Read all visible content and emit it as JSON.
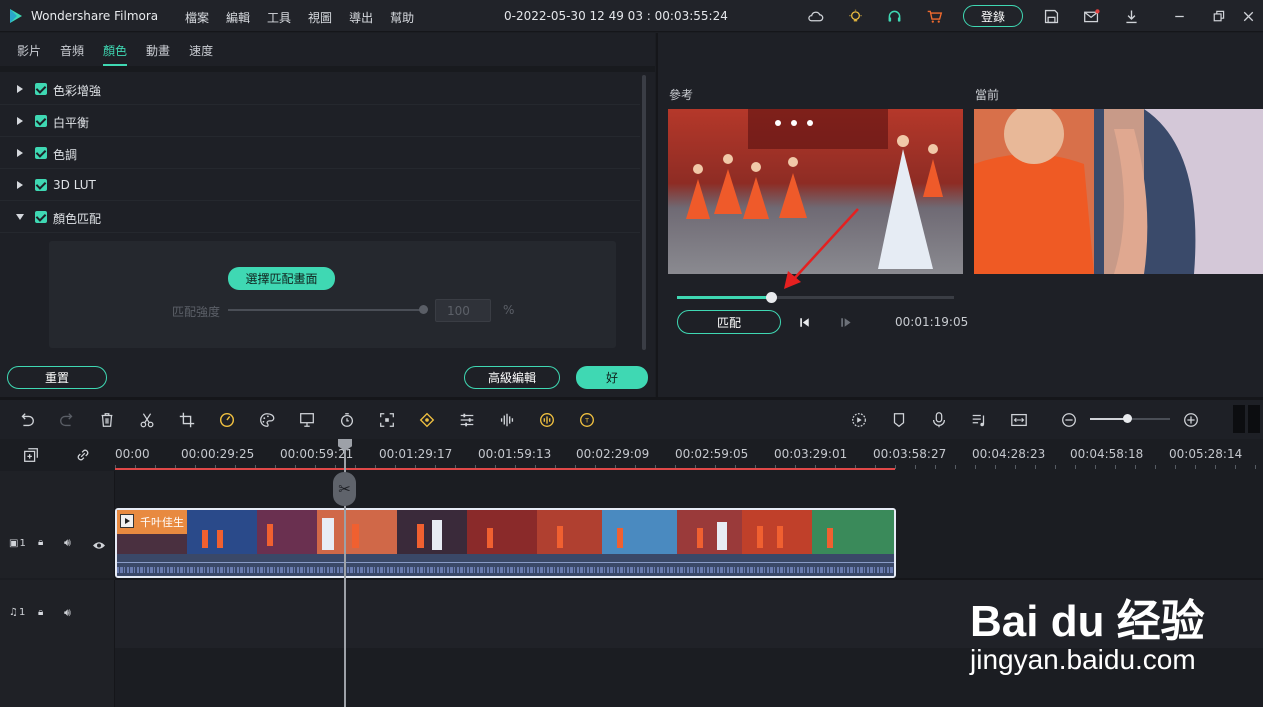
{
  "app": {
    "name": "Wondershare Filmora",
    "title": "0-2022-05-30 12 49 03 : 00:03:55:24",
    "login_label": "登錄"
  },
  "menu": [
    "檔案",
    "編輯",
    "工具",
    "視圖",
    "導出",
    "幫助"
  ],
  "tabs": [
    "影片",
    "音頻",
    "顏色",
    "動畫",
    "速度"
  ],
  "active_tab": "顏色",
  "sections": [
    "色彩增強",
    "白平衡",
    "色調",
    "3D LUT",
    "顏色匹配"
  ],
  "match": {
    "select_button": "選擇匹配畫面",
    "strength_label": "匹配強度",
    "strength_value": "100",
    "unit": "%",
    "strength_level": 1.0
  },
  "buttons": {
    "reset": "重置",
    "advanced": "高級編輯",
    "ok": "好"
  },
  "preview": {
    "reference_label": "參考",
    "current_label": "當前",
    "match_button": "匹配",
    "timecode": "00:01:19:05",
    "progress": 0.34
  },
  "ruler": [
    "00:00",
    "00:00:29:25",
    "00:00:59:21",
    "00:01:29:17",
    "00:01:59:13",
    "00:02:29:09",
    "00:02:59:05",
    "00:03:29:01",
    "00:03:58:27",
    "00:04:28:23",
    "00:04:58:18",
    "00:05:28:14"
  ],
  "clip": {
    "title": "千叶佳生"
  },
  "tracks": {
    "video": "1",
    "audio": "1"
  },
  "watermark": {
    "brand": "Bai du 经验",
    "url": "jingyan.baidu.com"
  },
  "colors": {
    "accent": "#3fd8b3",
    "playhead_range": "#e04848"
  }
}
